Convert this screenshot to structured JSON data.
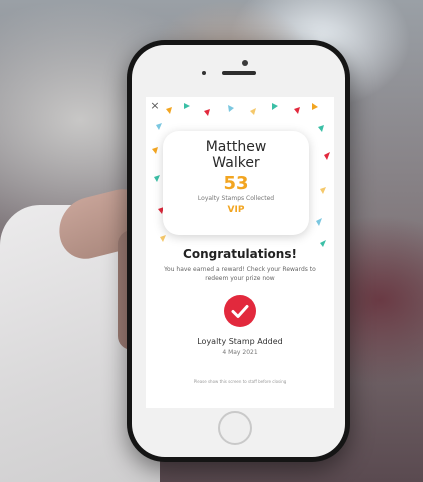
{
  "customer": {
    "first_name": "Matthew",
    "last_name": "Walker",
    "stamps": "53",
    "stamps_label": "Loyalty Stamps Collected",
    "tier": "VIP"
  },
  "message": {
    "heading": "Congratulations!",
    "body": "You have earned a reward! Check your Rewards to redeem your prize now"
  },
  "stamp": {
    "label": "Loyalty Stamp Added",
    "date": "4 May 2021"
  },
  "footer_note": "Please show this screen to staff before closing",
  "close_icon": "×",
  "colors": {
    "accent": "#f2a521",
    "check_red": "#e2293d",
    "confetti": [
      "#f2a521",
      "#3bbfa6",
      "#e2293d",
      "#7bc7e0",
      "#f5c86b"
    ]
  }
}
